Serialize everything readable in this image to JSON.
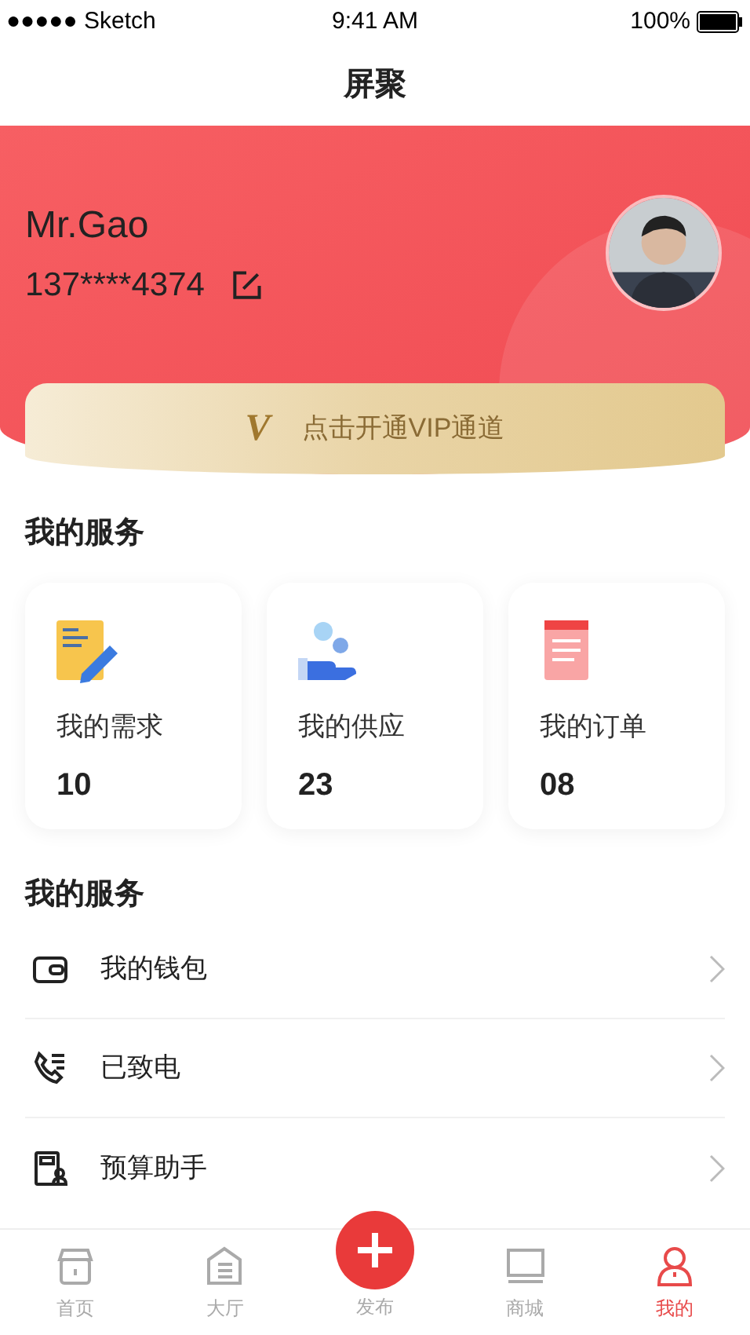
{
  "status_bar": {
    "carrier": "●●●●● Sketch",
    "time": "9:41 AM",
    "battery": "100%"
  },
  "nav": {
    "title": "屏聚"
  },
  "profile": {
    "name": "Mr.Gao",
    "phone": "137****4374"
  },
  "vip": {
    "mark": "V",
    "label": "点击开通VIP通道"
  },
  "services": {
    "title": "我的服务",
    "cards": [
      {
        "kind": "demand",
        "label": "我的需求",
        "count": "10"
      },
      {
        "kind": "supply",
        "label": "我的供应",
        "count": "23"
      },
      {
        "kind": "order",
        "label": "我的订单",
        "count": "08"
      }
    ]
  },
  "menu": {
    "title": "我的服务",
    "items": [
      {
        "kind": "wallet",
        "label": "我的钱包"
      },
      {
        "kind": "call",
        "label": "已致电"
      },
      {
        "kind": "budget",
        "label": "预算助手"
      }
    ]
  },
  "tabs": [
    {
      "kind": "home",
      "label": "首页",
      "selected": false
    },
    {
      "kind": "hall",
      "label": "大厅",
      "selected": false
    },
    {
      "kind": "publish",
      "label": "发布",
      "selected": false
    },
    {
      "kind": "shop",
      "label": "商城",
      "selected": false
    },
    {
      "kind": "mine",
      "label": "我的",
      "selected": true
    }
  ]
}
